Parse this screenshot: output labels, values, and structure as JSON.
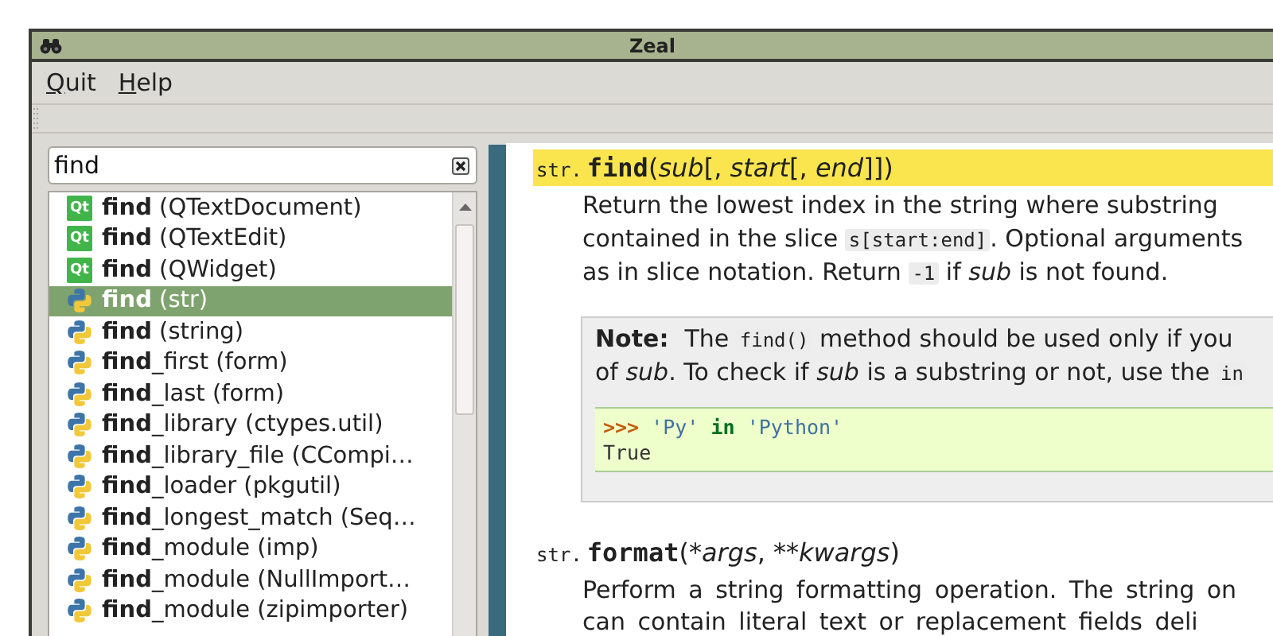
{
  "window": {
    "title": "Zeal"
  },
  "menu": [
    {
      "mnemonic": "Q",
      "rest": "uit"
    },
    {
      "mnemonic": "H",
      "rest": "elp"
    }
  ],
  "search": {
    "value": "find"
  },
  "results": [
    {
      "kind": "qt",
      "badge": "Qt",
      "label": "**find** (QTextDocument)",
      "selected": false
    },
    {
      "kind": "qt",
      "badge": "Qt",
      "label": "**find** (QTextEdit)",
      "selected": false
    },
    {
      "kind": "qt",
      "badge": "Qt",
      "label": "**find** (QWidget)",
      "selected": false
    },
    {
      "kind": "python",
      "label": "**find** (str)",
      "selected": true
    },
    {
      "kind": "python",
      "label": "**find** (string)",
      "selected": false
    },
    {
      "kind": "python",
      "label": "**find**_first (form)",
      "selected": false
    },
    {
      "kind": "python",
      "label": "**find**_last (form)",
      "selected": false
    },
    {
      "kind": "python",
      "label": "**find**_library (ctypes.util)",
      "selected": false
    },
    {
      "kind": "python",
      "label": "**find**_library_file (CCompi…",
      "selected": false
    },
    {
      "kind": "python",
      "label": "**find**_loader (pkgutil)",
      "selected": false
    },
    {
      "kind": "python",
      "label": "**find**_longest_match (Seq…",
      "selected": false
    },
    {
      "kind": "python",
      "label": "**find**_module (imp)",
      "selected": false
    },
    {
      "kind": "python",
      "label": "**find**_module (NullImport…",
      "selected": false
    },
    {
      "kind": "python",
      "label": "**find**_module (zipimporter)",
      "selected": false
    }
  ],
  "doc": [
    {
      "kind": "signature",
      "prefix": "str.",
      "name": "find",
      "args": [
        {
          "kind": "text",
          "text": "("
        },
        {
          "kind": "em",
          "text": "sub"
        },
        {
          "kind": "text",
          "text": "[, "
        },
        {
          "kind": "em",
          "text": "start"
        },
        {
          "kind": "text",
          "text": "[, "
        },
        {
          "kind": "em",
          "text": "end"
        },
        {
          "kind": "text",
          "text": "]])"
        }
      ],
      "highlighted": true
    },
    {
      "kind": "paragraph",
      "justified": false,
      "lines": [
        [
          {
            "kind": "text",
            "text": "Return the lowest index in the string where substring"
          }
        ],
        [
          {
            "kind": "text",
            "text": "contained in the slice "
          },
          {
            "kind": "code",
            "text": "s[start:end]"
          },
          {
            "kind": "text",
            "text": ". Optional arguments"
          }
        ],
        [
          {
            "kind": "text",
            "text": "as in slice notation. Return "
          },
          {
            "kind": "code",
            "text": "-1"
          },
          {
            "kind": "text",
            "text": " if *sub* is not found."
          }
        ]
      ]
    },
    {
      "kind": "note",
      "title": "Note:",
      "lines": [
        [
          {
            "kind": "text",
            "text": "The "
          },
          {
            "kind": "code",
            "text": "find()"
          },
          {
            "kind": "text",
            "text": " method should be used only if you"
          }
        ],
        [
          {
            "kind": "text",
            "text": "of *sub*. To check if *sub* is a substring or not, use the "
          },
          {
            "kind": "code",
            "text": "in"
          }
        ]
      ],
      "example": [
        [
          {
            "kind": "prompt",
            "text": ">>>"
          },
          {
            "kind": "string",
            "text": "'Py'"
          },
          {
            "kind": "keyword",
            "text": "in"
          },
          {
            "kind": "string",
            "text": "'Python'"
          }
        ],
        [
          {
            "kind": "output",
            "text": "True"
          }
        ]
      ]
    },
    {
      "kind": "signature",
      "prefix": "str.",
      "name": "format",
      "args": [
        {
          "kind": "text",
          "text": "(*"
        },
        {
          "kind": "em",
          "text": "args"
        },
        {
          "kind": "text",
          "text": ", **"
        },
        {
          "kind": "em",
          "text": "kwargs"
        },
        {
          "kind": "text",
          "text": ")"
        }
      ],
      "highlighted": false
    },
    {
      "kind": "paragraph",
      "justified": true,
      "lines": [
        [
          {
            "kind": "text",
            "text": "Perform a string formatting operation. The string on"
          }
        ],
        [
          {
            "kind": "text",
            "text": "can contain literal text or replacement fields deli"
          }
        ]
      ]
    }
  ]
}
